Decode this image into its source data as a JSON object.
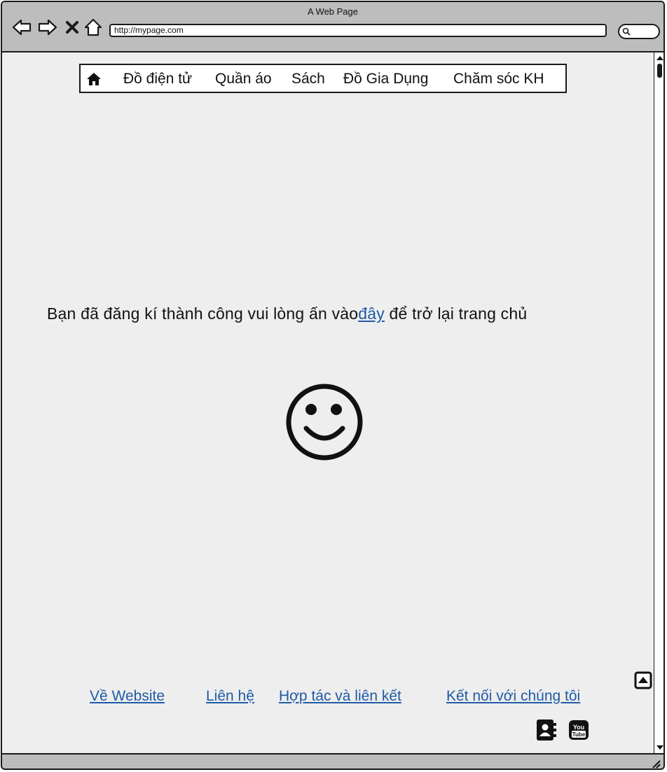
{
  "browser": {
    "title": "A Web Page",
    "url": "http://mypage.com",
    "icons": [
      "back-arrow-icon",
      "forward-arrow-icon",
      "close-icon",
      "home-icon",
      "search-icon"
    ]
  },
  "navbar": {
    "home_icon": "home-icon",
    "items": [
      {
        "label": "Đồ điện tử"
      },
      {
        "label": "Quần áo"
      },
      {
        "label": "Sách"
      },
      {
        "label": "Đồ Gia Dụng"
      },
      {
        "label": "Chăm sóc KH"
      }
    ]
  },
  "message": {
    "before": "Bạn đã đăng kí thành công vui lòng ấn vào",
    "link": "đây",
    "after": " để trở lại trang chủ"
  },
  "smiley_icon": "smiley-face-icon",
  "footer": {
    "links": [
      {
        "label": "Về Website"
      },
      {
        "label": "Liên hệ"
      },
      {
        "label": "Hợp tác và liên kết"
      },
      {
        "label": "Kết nối với chúng tôi"
      }
    ],
    "back_to_top_icon": "arrow-up-box-icon",
    "social_icons": [
      "contact-book-icon",
      "youtube-icon"
    ],
    "youtube_text": [
      "You",
      "Tube"
    ]
  },
  "colors": {
    "link": "#1f5aa6",
    "chrome": "#bdbdbd",
    "page_background": "#eeeeee"
  }
}
